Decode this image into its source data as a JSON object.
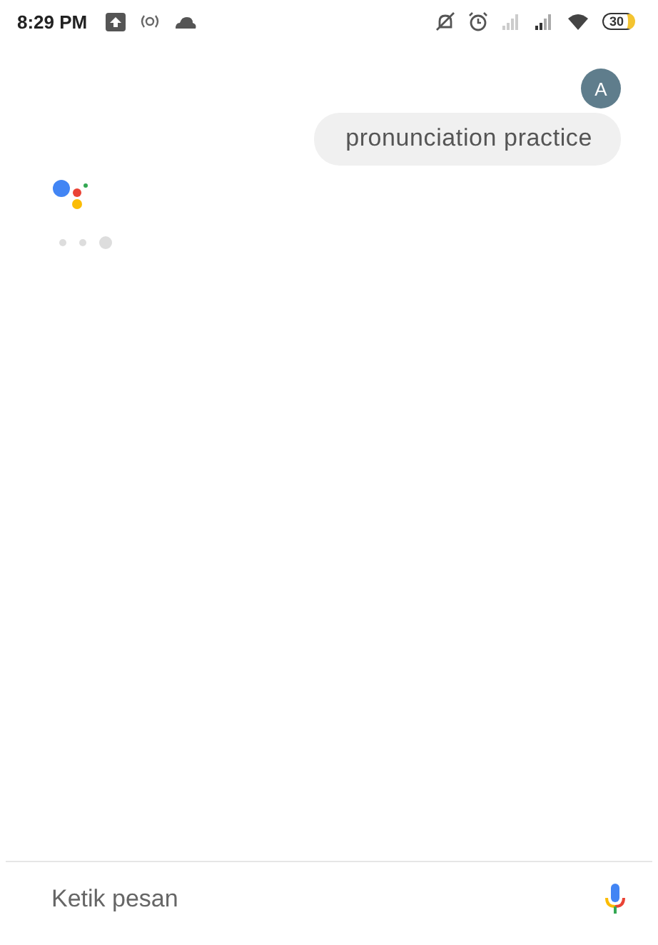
{
  "status_bar": {
    "time": "8:29 PM",
    "battery": "30"
  },
  "conversation": {
    "user_avatar": "A",
    "user_message": "pronunciation practice"
  },
  "composer": {
    "placeholder": "Ketik pesan"
  }
}
